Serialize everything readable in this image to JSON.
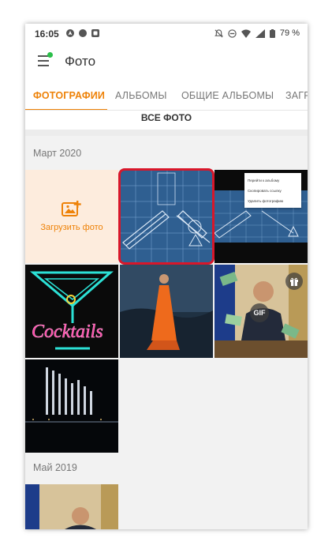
{
  "status_bar": {
    "time": "16:05",
    "battery": "79 %"
  },
  "app_bar": {
    "title": "Фото"
  },
  "tabs": [
    {
      "label": "ФОТОГРАФИИ",
      "active": true
    },
    {
      "label": "АЛЬБОМЫ",
      "active": false
    },
    {
      "label": "ОБЩИЕ АЛЬБОМЫ",
      "active": false
    },
    {
      "label": "ЗАГРУ",
      "active": false
    }
  ],
  "filter": {
    "label": "ВСЕ ФОТО"
  },
  "sections": [
    {
      "label": "Март 2020"
    },
    {
      "label": "Май 2019"
    }
  ],
  "upload": {
    "label": "Загрузить фото"
  },
  "context_menu": {
    "items": [
      "Перейти к альбому",
      "Скопировать ссылку",
      "Удалить фотографию"
    ]
  },
  "gif_badge": "GIF",
  "cocktails_text": "Cocktails",
  "colors": {
    "accent": "#ee8208",
    "selection": "#d8172a",
    "blueprint": "#2f5f91"
  }
}
